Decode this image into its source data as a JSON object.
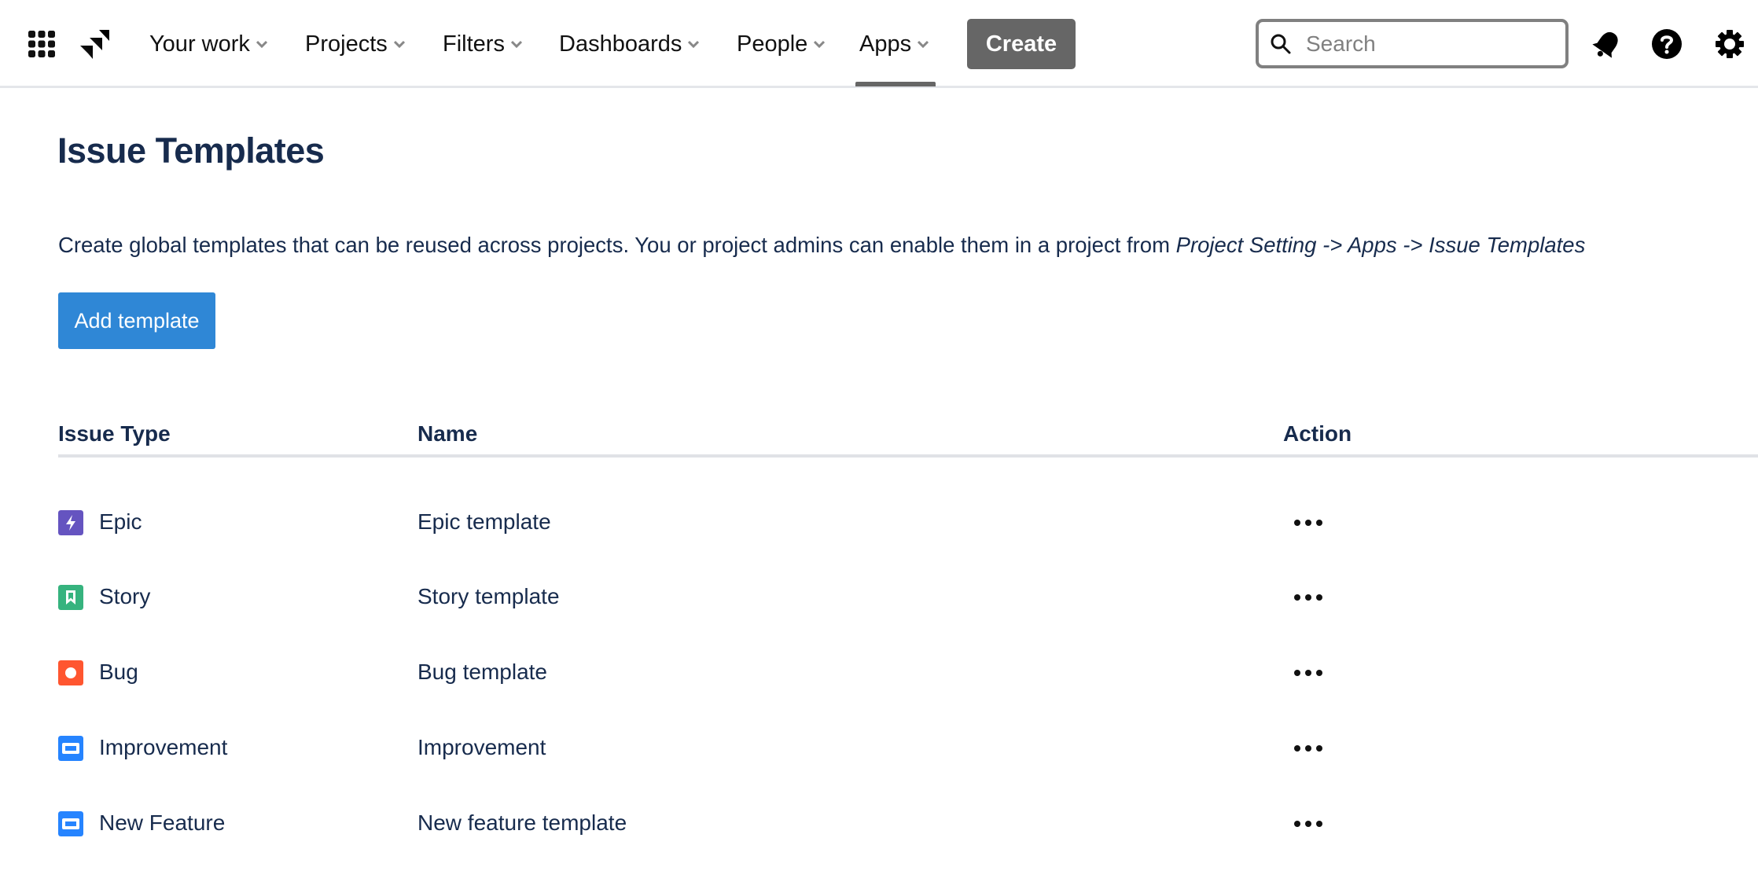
{
  "nav": {
    "items": [
      {
        "label": "Your work"
      },
      {
        "label": "Projects"
      },
      {
        "label": "Filters"
      },
      {
        "label": "Dashboards"
      },
      {
        "label": "People"
      },
      {
        "label": "Apps",
        "active": true
      }
    ],
    "create_label": "Create",
    "search_placeholder": "Search",
    "search_value": ""
  },
  "page": {
    "title": "Issue Templates",
    "description_prefix": "Create global templates that can be reused across projects. You or project admins can enable them in a project from ",
    "description_path": "Project Setting -> Apps -> Issue Templates",
    "add_button_label": "Add template"
  },
  "table": {
    "columns": [
      "Issue Type",
      "Name",
      "Action"
    ],
    "rows": [
      {
        "issue_type": "Epic",
        "icon": "epic-icon",
        "color": "#6554C0",
        "name": "Epic template"
      },
      {
        "issue_type": "Story",
        "icon": "story-icon",
        "color": "#36B37E",
        "name": "Story template"
      },
      {
        "issue_type": "Bug",
        "icon": "bug-icon",
        "color": "#FF5630",
        "name": "Bug template"
      },
      {
        "issue_type": "Improvement",
        "icon": "improvement-icon",
        "color": "#2684FF",
        "name": "Improvement"
      },
      {
        "issue_type": "New Feature",
        "icon": "new-feature-icon",
        "color": "#2684FF",
        "name": "New feature template"
      }
    ]
  },
  "colors": {
    "primary_text": "#172B4D",
    "add_button": "#2F87D6",
    "create_button": "#666666"
  }
}
